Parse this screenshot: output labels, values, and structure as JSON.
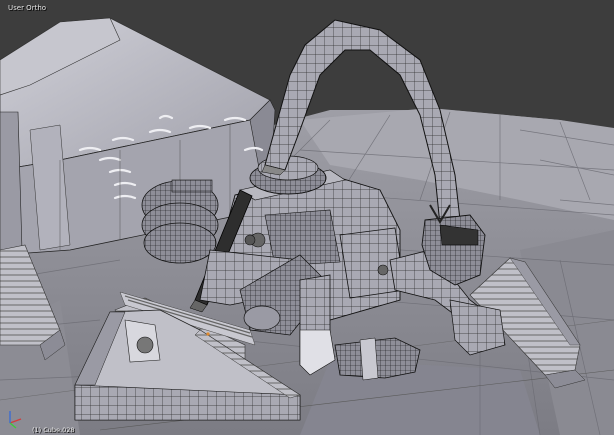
{
  "viewport": {
    "view_label": "User Ortho",
    "object_label": "(1) Cube.028"
  },
  "colors": {
    "background": "#3d3d3d",
    "mesh_face": "#b4b4bd",
    "wire": "#000000",
    "grid_line": "#555555",
    "axis_x": "#d23c3c",
    "axis_y": "#3cc83c",
    "axis_z": "#3c6ed2"
  },
  "icons": [
    "axis-gizmo-icon"
  ]
}
